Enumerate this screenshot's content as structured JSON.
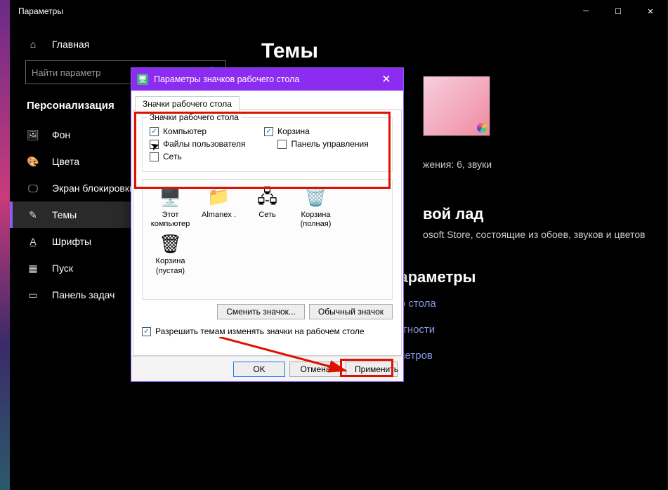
{
  "window": {
    "title": "Параметры"
  },
  "sidebar": {
    "home": "Главная",
    "search_placeholder": "Найти параметр",
    "section": "Персонализация",
    "items": [
      {
        "label": "Фон"
      },
      {
        "label": "Цвета"
      },
      {
        "label": "Экран блокировки"
      },
      {
        "label": "Темы"
      },
      {
        "label": "Шрифты"
      },
      {
        "label": "Пуск"
      },
      {
        "label": "Панель задач"
      }
    ]
  },
  "page": {
    "title": "Темы",
    "theme_caption": "жения: 6, звуки",
    "section2_head": "вой лад",
    "section2_body": "osoft Store, состоящие из обоев, звуков и цветов",
    "related_head": "Сопутствующие параметры",
    "links": [
      "Параметры значков рабочего стола",
      "Параметры высокой контрастности",
      "Синхронизация ваших параметров"
    ]
  },
  "dialog": {
    "title": "Параметры значков рабочего стола",
    "tab": "Значки рабочего стола",
    "group_label": "Значки рабочего стола",
    "checks": {
      "computer": "Компьютер",
      "recycle": "Корзина",
      "userfiles": "Файлы пользователя",
      "controlpanel": "Панель управления",
      "network": "Сеть"
    },
    "icons": [
      {
        "label": "Этот компьютер"
      },
      {
        "label": "Almanex ."
      },
      {
        "label": "Сеть"
      },
      {
        "label": "Корзина (полная)"
      },
      {
        "label": ""
      },
      {
        "label": "Корзина (пустая)"
      }
    ],
    "change_btn": "Сменить значок...",
    "default_btn": "Обычный значок",
    "allow_themes": "Разрешить темам изменять значки на рабочем столе",
    "ok": "OK",
    "cancel": "Отмена",
    "apply": "Применить"
  }
}
